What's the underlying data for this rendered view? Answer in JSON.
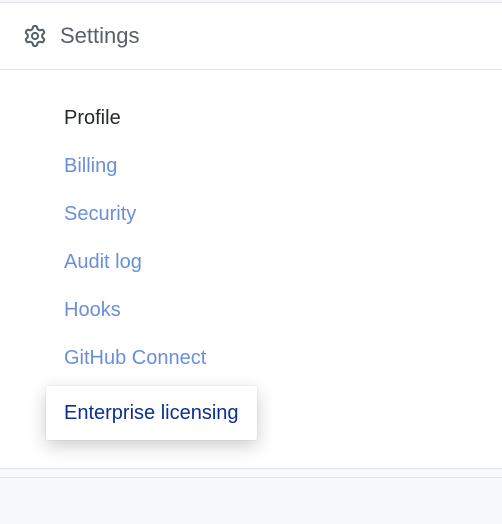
{
  "header": {
    "title": "Settings"
  },
  "nav": {
    "items": [
      {
        "label": "Profile",
        "state": "current"
      },
      {
        "label": "Billing",
        "state": "link"
      },
      {
        "label": "Security",
        "state": "link"
      },
      {
        "label": "Audit log",
        "state": "link"
      },
      {
        "label": "Hooks",
        "state": "link"
      },
      {
        "label": "GitHub Connect",
        "state": "link"
      },
      {
        "label": "Enterprise licensing",
        "state": "highlighted"
      }
    ]
  }
}
